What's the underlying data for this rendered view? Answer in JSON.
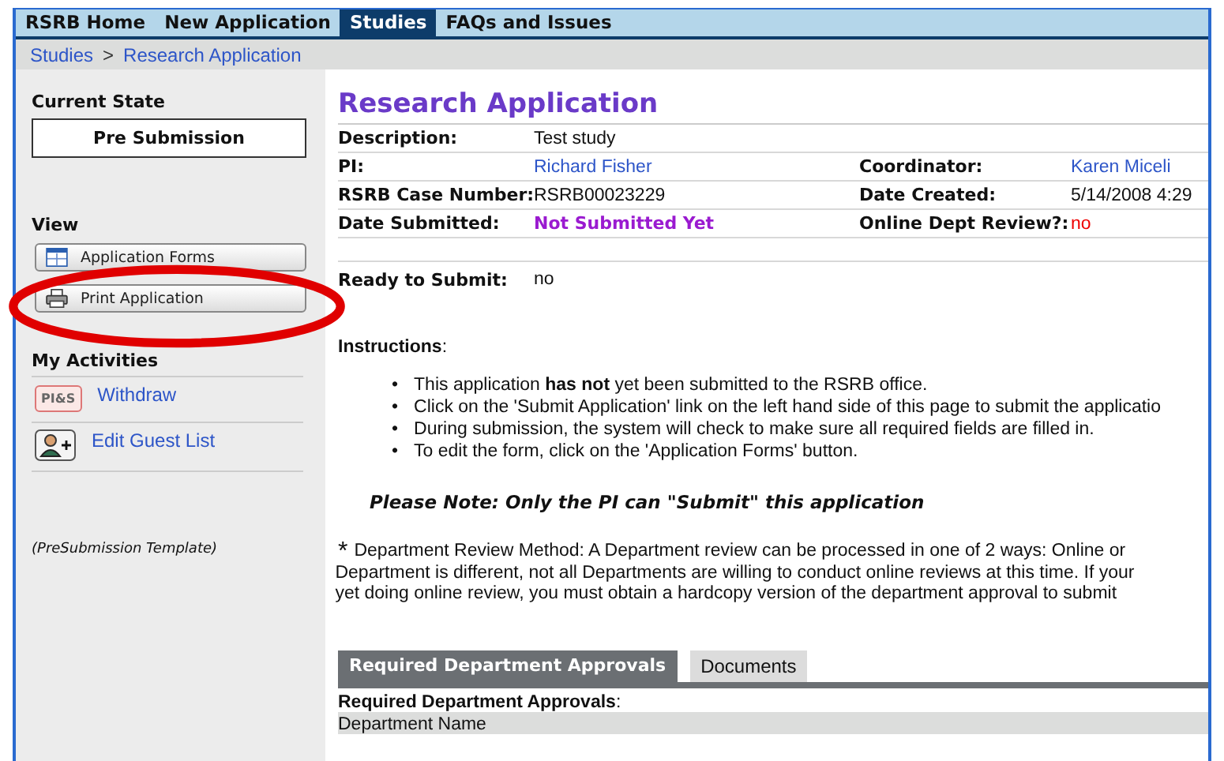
{
  "nav": {
    "tabs": [
      {
        "label": "RSRB Home",
        "selected": false
      },
      {
        "label": "New Application",
        "selected": false
      },
      {
        "label": "Studies",
        "selected": true
      },
      {
        "label": "FAQs and Issues",
        "selected": false
      }
    ]
  },
  "breadcrumb": {
    "items": [
      "Studies",
      "Research Application"
    ],
    "separator": ">"
  },
  "sidebar": {
    "current_state_heading": "Current State",
    "current_state": "Pre Submission",
    "view_heading": "View",
    "view_buttons": [
      {
        "label": "Application Forms",
        "kind": "form"
      },
      {
        "label": "Print Application",
        "kind": "printer"
      }
    ],
    "activities_heading": "My Activities",
    "activities": [
      {
        "label": "Withdraw",
        "kind": "badge",
        "badge": "PI&S"
      },
      {
        "label": "Edit Guest List",
        "kind": "add-person"
      }
    ],
    "template_note": "(PreSubmission Template)"
  },
  "main": {
    "title": "Research Application",
    "rows": [
      [
        {
          "label": "Description:",
          "value": "Test study",
          "kind": "text"
        }
      ],
      [
        {
          "label": "PI:",
          "value": "Richard Fisher",
          "kind": "link"
        },
        {
          "label": "Coordinator:",
          "value": "Karen Miceli",
          "kind": "link"
        }
      ],
      [
        {
          "label": "RSRB Case Number:",
          "value": "RSRB00023229",
          "kind": "text"
        },
        {
          "label": "Date Created:",
          "value": "5/14/2008 4:29",
          "kind": "text"
        }
      ],
      [
        {
          "label": "Date Submitted:",
          "value": "Not Submitted Yet",
          "kind": "emphasis"
        },
        {
          "label": "Online Dept Review?:",
          "value": "no",
          "kind": "alert"
        }
      ]
    ],
    "ready": {
      "label": "Ready to Submit:",
      "value": "no"
    },
    "instructions_heading": "**Instructions**:",
    "bullet": "•",
    "instructions": [
      "This application **has not** yet been submitted to the RSRB office.",
      "Click on the 'Submit Application' link on the left hand side of this page to submit the applicatio",
      "During submission, the system will check to make sure all required fields are filled in.",
      "To edit the form, click on the 'Application Forms' button."
    ],
    "note": "Please Note: Only the PI can \"Submit\" this application",
    "footnote_mark": "*",
    "footnote_lines": [
      "Department Review Method:  A Department review can be processed in one of 2 ways: Online or",
      "Department is different, not all Departments are willing to conduct online reviews at this time. If your",
      "yet doing online review, you must obtain a hardcopy version of the department approval to submit"
    ],
    "tabs": [
      {
        "label": "Required Department Approvals",
        "selected": true
      },
      {
        "label": "Documents",
        "selected": false
      }
    ],
    "section_heading": "**Required Department Approvals**:",
    "column_header": "Department Name"
  }
}
